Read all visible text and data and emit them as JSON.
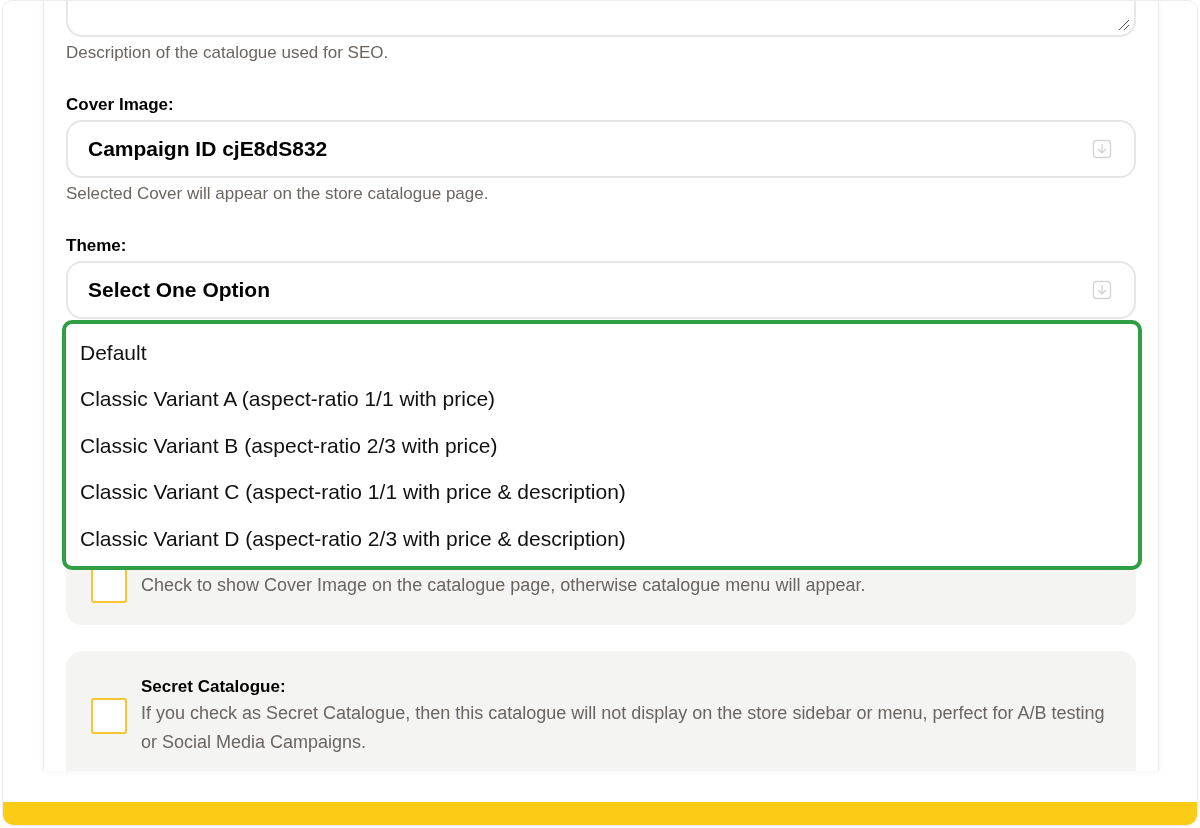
{
  "description_field": {
    "help": "Description of the catalogue used for SEO."
  },
  "cover_image": {
    "label": "Cover Image:",
    "value": "Campaign ID cjE8dS832",
    "help": "Selected Cover will appear on the store catalogue page."
  },
  "theme": {
    "label": "Theme:",
    "value": "Select One Option",
    "options": [
      {
        "label": "Default",
        "selected": false
      },
      {
        "label": "Classic Variant A (aspect-ratio 1/1 with price)",
        "selected": false
      },
      {
        "label": "Classic Variant B (aspect-ratio 2/3 with price)",
        "selected": false
      },
      {
        "label": "Classic Variant C (aspect-ratio 1/1 with price & description)",
        "selected": false
      },
      {
        "label": "Classic Variant D (aspect-ratio 2/3 with price & description)",
        "selected": false
      }
    ]
  },
  "checkbox_panels": [
    {
      "description": "Check to show Cover Image on the catalogue page, otherwise catalogue menu will appear.",
      "checked": false
    },
    {
      "title": "Secret Catalogue:",
      "description": "If you check as Secret Catalogue, then this catalogue will not display on the store sidebar or menu, perfect for A/B testing or Social Media Campaigns.",
      "checked": false
    }
  ]
}
